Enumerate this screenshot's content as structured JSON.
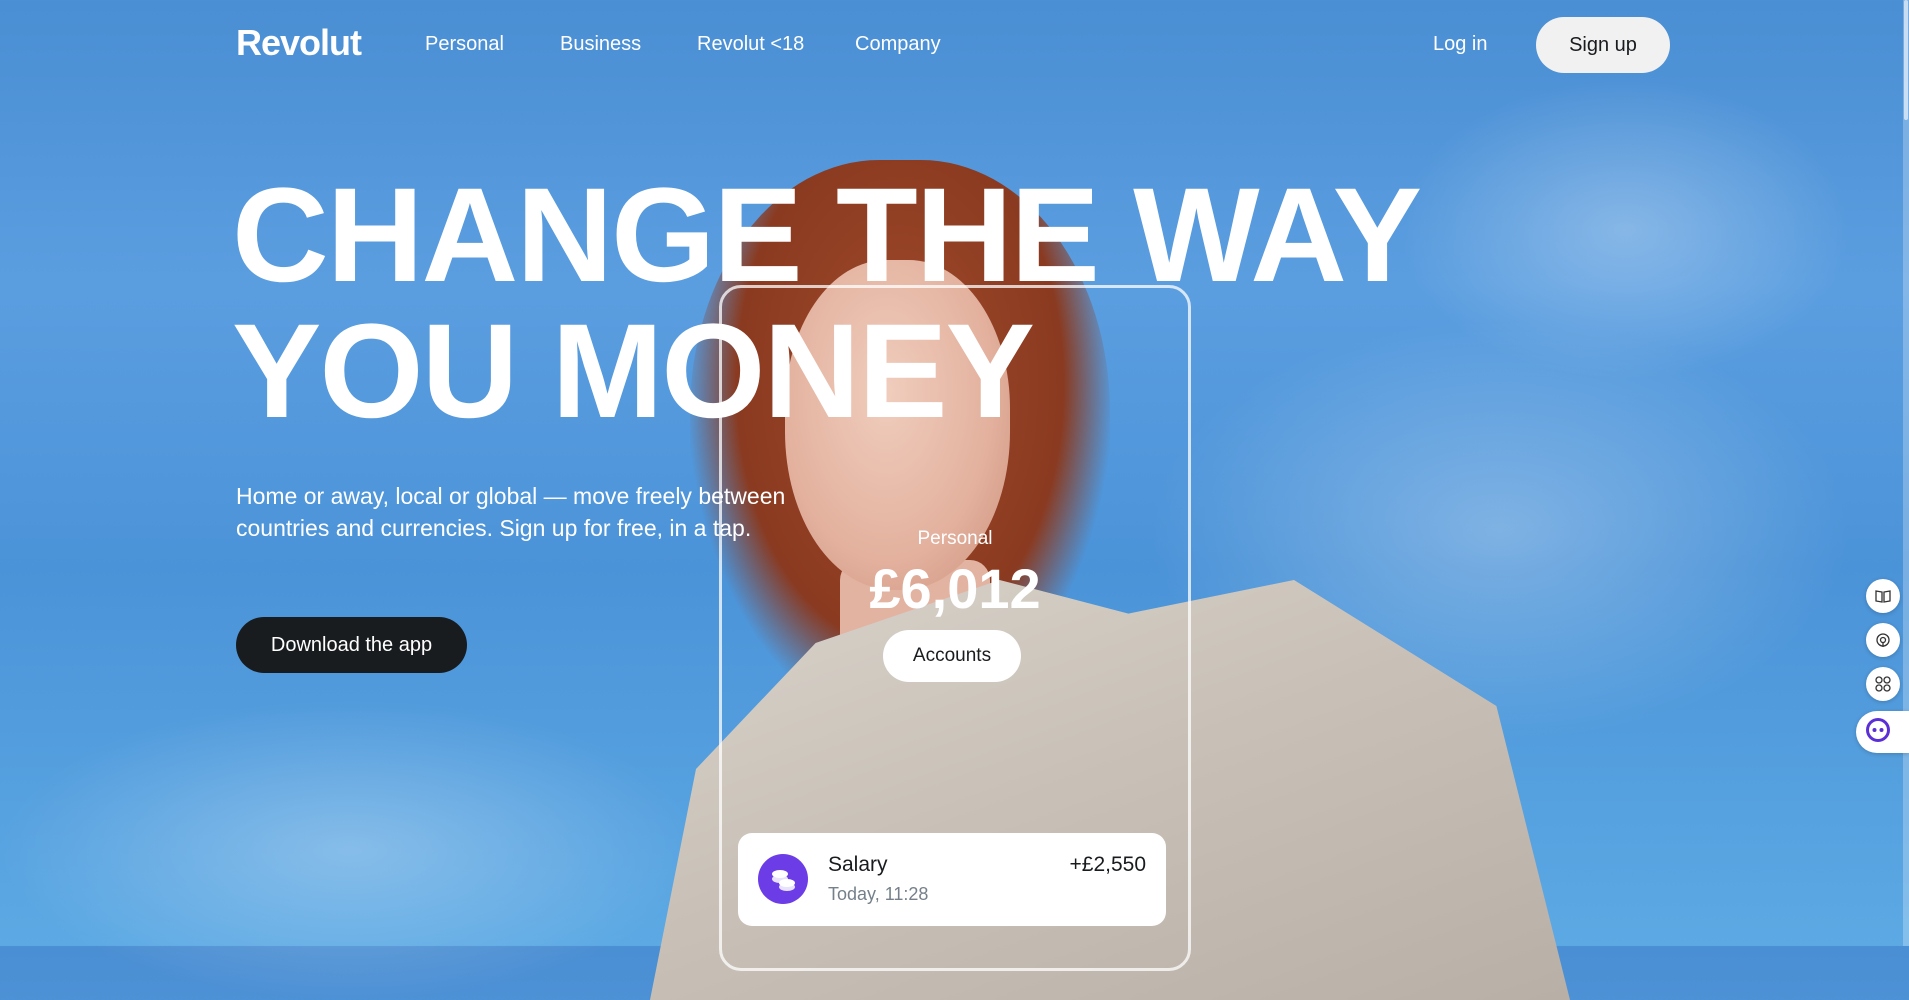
{
  "header": {
    "logo": "Revolut",
    "nav": [
      "Personal",
      "Business",
      "Revolut <18",
      "Company"
    ],
    "login": "Log in",
    "signup": "Sign up"
  },
  "hero": {
    "headline_line1": "CHANGE THE WAY",
    "headline_line2": "YOU MONEY",
    "subtext": "Home or away, local or global — move freely between countries and currencies. Sign up for free, in a tap.",
    "download_label": "Download the app"
  },
  "phone": {
    "account_label": "Personal",
    "balance": "£6,012",
    "accounts_button": "Accounts",
    "transaction": {
      "title": "Salary",
      "time": "Today, 11:28",
      "amount": "+£2,550"
    }
  },
  "side_tools": [
    "book-icon",
    "broadcast-icon",
    "apps-grid-icon",
    "assistant-face-icon"
  ],
  "colors": {
    "sky": "#5b9ee0",
    "button_dark": "#191c1f",
    "accent_purple": "#6c3ce6"
  }
}
